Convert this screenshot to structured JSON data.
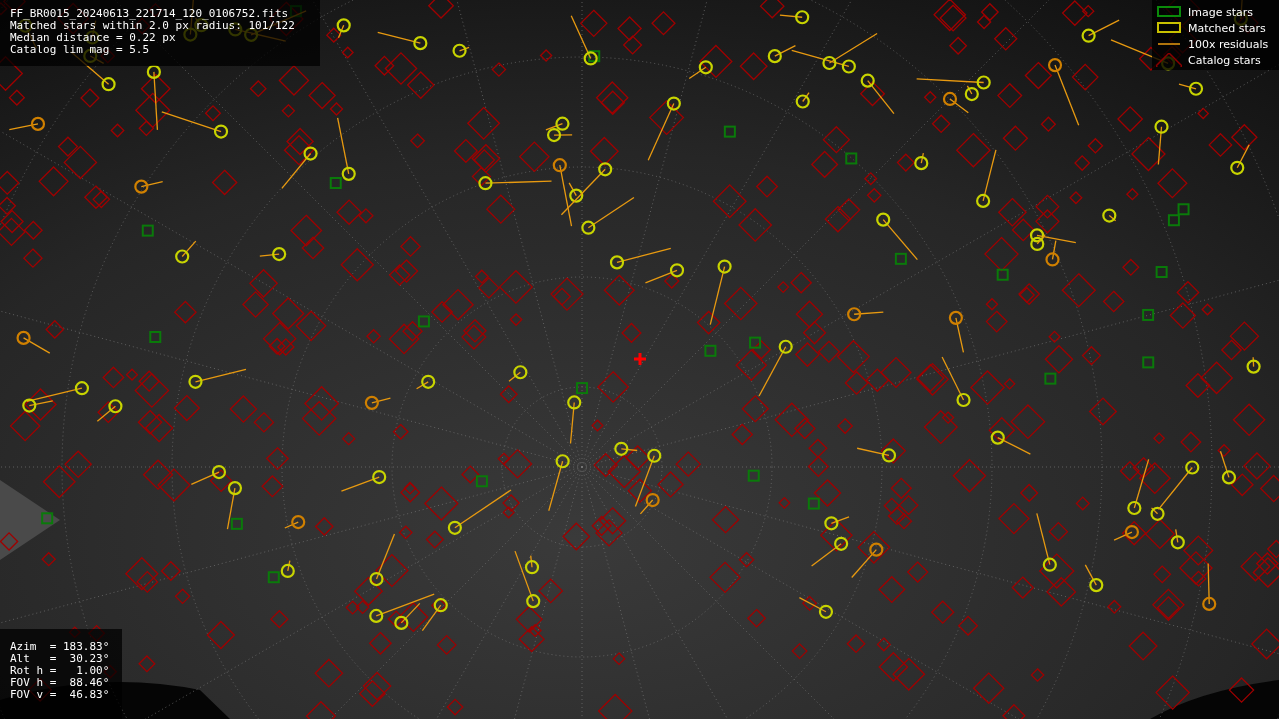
{
  "info_top": [
    "FF_BR0015_20240613_221714_120_0106752.fits",
    "Matched stars within 2.0 px radius: 101/122",
    "Median distance = 0.22 px",
    "Catalog lim mag = 5.5"
  ],
  "legend": [
    {
      "kind": "image",
      "label": "Image stars"
    },
    {
      "kind": "matched",
      "label": "Matched stars"
    },
    {
      "kind": "residual",
      "label": "100x residuals"
    },
    {
      "kind": "catalog",
      "label": "Catalog stars"
    }
  ],
  "info_bottom": [
    "Azim  = 183.83°",
    "Alt   =  30.23°",
    "Rot h =   1.00°",
    "FOV h =  88.46°",
    "FOV v =  46.83°"
  ]
}
